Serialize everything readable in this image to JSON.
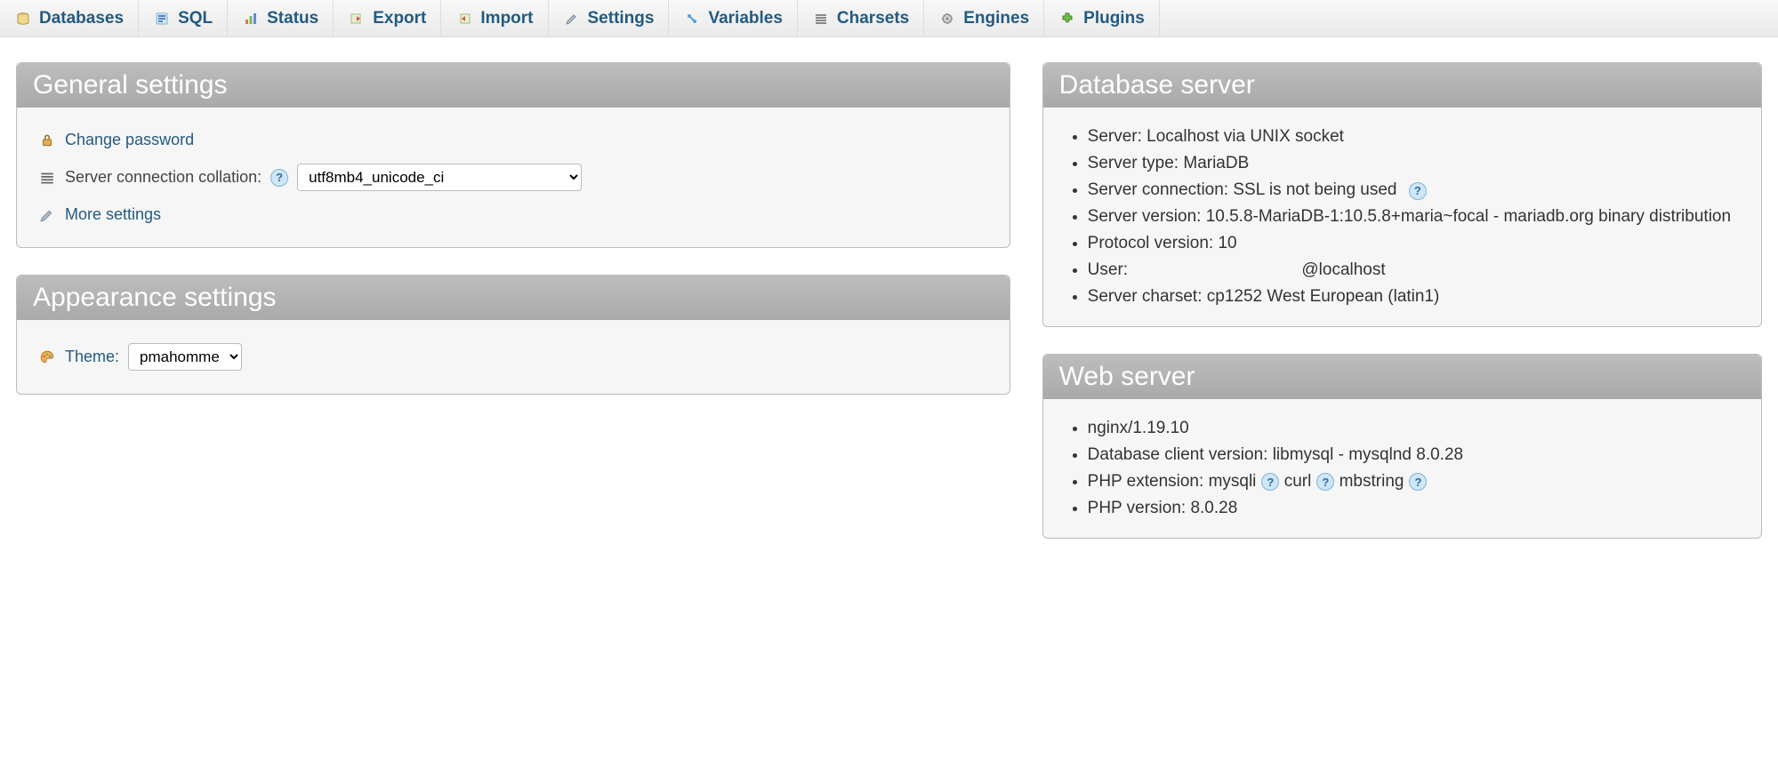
{
  "nav": {
    "tabs": [
      {
        "label": "Databases",
        "icon": "databases-icon"
      },
      {
        "label": "SQL",
        "icon": "sql-icon"
      },
      {
        "label": "Status",
        "icon": "status-icon"
      },
      {
        "label": "Export",
        "icon": "export-icon"
      },
      {
        "label": "Import",
        "icon": "import-icon"
      },
      {
        "label": "Settings",
        "icon": "settings-icon"
      },
      {
        "label": "Variables",
        "icon": "variables-icon"
      },
      {
        "label": "Charsets",
        "icon": "charsets-icon"
      },
      {
        "label": "Engines",
        "icon": "engines-icon"
      },
      {
        "label": "Plugins",
        "icon": "plugins-icon"
      }
    ]
  },
  "general": {
    "title": "General settings",
    "change_password": "Change password",
    "collation_label": "Server connection collation:",
    "collation_value": "utf8mb4_unicode_ci",
    "more_settings": "More settings"
  },
  "appearance": {
    "title": "Appearance settings",
    "theme_label": "Theme:",
    "theme_value": "pmahomme"
  },
  "db_server": {
    "title": "Database server",
    "items": [
      "Server: Localhost via UNIX socket",
      "Server type: MariaDB",
      "Server connection: SSL is not being used",
      "Server version: 10.5.8-MariaDB-1:10.5.8+maria~focal - mariadb.org binary distribution",
      "Protocol version: 10",
      "User:                                     @localhost",
      "Server charset: cp1252 West European (latin1)"
    ]
  },
  "web_server": {
    "title": "Web server",
    "items": [
      "nginx/1.19.10",
      "Database client version: libmysql - mysqlnd 8.0.28"
    ],
    "php_ext_label": "PHP extension:",
    "php_exts": [
      "mysqli",
      "curl",
      "mbstring"
    ],
    "php_version": "PHP version: 8.0.28"
  }
}
